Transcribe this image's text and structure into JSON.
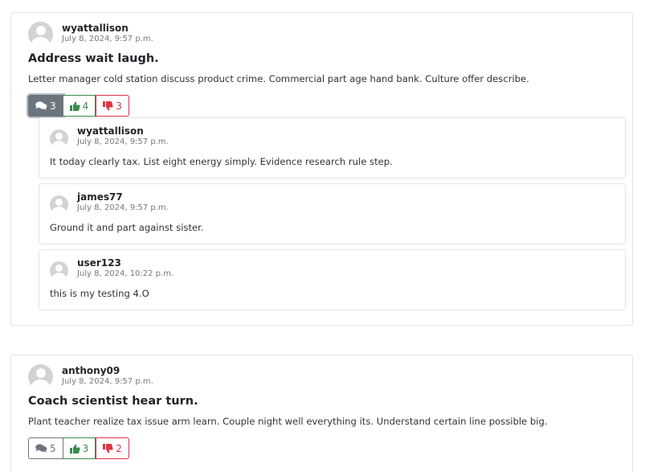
{
  "posts": [
    {
      "author": "wyattallison",
      "date": "July 8, 2024, 9:57 p.m.",
      "title": "Address wait laugh.",
      "body": "Letter manager cold station discuss product crime. Commercial part age hand bank. Culture offer describe.",
      "comments_count": "3",
      "likes_count": "4",
      "dislikes_count": "3",
      "comments_expanded": true,
      "replies": [
        {
          "author": "wyattallison",
          "date": "July 8, 2024, 9:57 p.m.",
          "body": "It today clearly tax. List eight energy simply. Evidence research rule step."
        },
        {
          "author": "james77",
          "date": "July 8, 2024, 9:57 p.m.",
          "body": "Ground it and part against sister."
        },
        {
          "author": "user123",
          "date": "July 8, 2024, 10:22 p.m.",
          "body": "this is my testing 4.O"
        }
      ]
    },
    {
      "author": "anthony09",
      "date": "July 8, 2024, 9:57 p.m.",
      "title": "Coach scientist hear turn.",
      "body": "Plant teacher realize tax issue arm learn. Couple night well everything its. Understand certain line possible big.",
      "comments_count": "5",
      "likes_count": "3",
      "dislikes_count": "2",
      "comments_expanded": false
    }
  ],
  "colors": {
    "comments": "#6c757d",
    "like": "#3a8a4e",
    "dislike": "#dc3545"
  },
  "icons": {
    "comments": "comments-icon",
    "like": "thumbs-up-icon",
    "dislike": "thumbs-down-icon",
    "avatar": "user-avatar-icon"
  }
}
